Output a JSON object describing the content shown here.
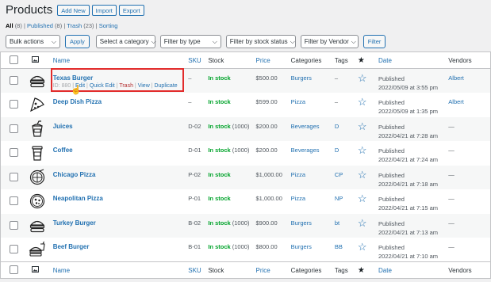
{
  "header": {
    "title": "Products",
    "add_new": "Add New",
    "import": "Import",
    "export": "Export"
  },
  "views": {
    "all": "All",
    "all_count": "(8)",
    "published": "Published",
    "published_count": "(8)",
    "trash": "Trash",
    "trash_count": "(23)",
    "sorting": "Sorting",
    "sep": "|"
  },
  "filters": {
    "bulk_actions": "Bulk actions",
    "apply": "Apply",
    "category": "Select a category",
    "type": "Filter by type",
    "stock": "Filter by stock status",
    "vendor": "Filter by Vendor",
    "filter": "Filter"
  },
  "columns": {
    "name": "Name",
    "sku": "SKU",
    "stock": "Stock",
    "price": "Price",
    "categories": "Categories",
    "tags": "Tags",
    "date": "Date",
    "vendors": "Vendors"
  },
  "row_actions": {
    "id": "ID: 880",
    "edit": "Edit",
    "quick_edit": "Quick Edit",
    "trash": "Trash",
    "view": "View",
    "duplicate": "Duplicate",
    "sep": "|"
  },
  "products": [
    {
      "name": "Texas Burger",
      "sku": "–",
      "stock": "In stock",
      "stock_qty": "",
      "price": "$500.00",
      "category": "Burgers",
      "tag": "–",
      "date_status": "Published",
      "date": "2022/05/09 at 3:55 pm",
      "vendor": "Albert",
      "icon": "burger-icon"
    },
    {
      "name": "Deep Dish Pizza",
      "sku": "–",
      "stock": "In stock",
      "stock_qty": "",
      "price": "$599.00",
      "category": "Pizza",
      "tag": "–",
      "date_status": "Published",
      "date": "2022/05/09 at 1:35 pm",
      "vendor": "Albert",
      "icon": "pizza-slice-icon"
    },
    {
      "name": "Juices",
      "sku": "D-02",
      "stock": "In stock",
      "stock_qty": "(1000)",
      "price": "$200.00",
      "category": "Beverages",
      "tag": "D",
      "date_status": "Published",
      "date": "2022/04/21 at 7:28 am",
      "vendor": "—",
      "icon": "juice-cup-icon"
    },
    {
      "name": "Coffee",
      "sku": "D-01",
      "stock": "In stock",
      "stock_qty": "(1000)",
      "price": "$200.00",
      "category": "Beverages",
      "tag": "D",
      "date_status": "Published",
      "date": "2022/04/21 at 7:24 am",
      "vendor": "—",
      "icon": "coffee-cup-icon"
    },
    {
      "name": "Chicago Pizza",
      "sku": "P-02",
      "stock": "In stock",
      "stock_qty": "",
      "price": "$1,000.00",
      "category": "Pizza",
      "tag": "CP",
      "date_status": "Published",
      "date": "2022/04/21 at 7:18 am",
      "vendor": "—",
      "icon": "pizza-whole-icon"
    },
    {
      "name": "Neapolitan Pizza",
      "sku": "P-01",
      "stock": "In stock",
      "stock_qty": "",
      "price": "$1,000.00",
      "category": "Pizza",
      "tag": "NP",
      "date_status": "Published",
      "date": "2022/04/21 at 7:15 am",
      "vendor": "—",
      "icon": "pizza-round-icon"
    },
    {
      "name": "Turkey Burger",
      "sku": "B-02",
      "stock": "In stock",
      "stock_qty": "(1000)",
      "price": "$900.00",
      "category": "Burgers",
      "tag": "bt",
      "date_status": "Published",
      "date": "2022/04/21 at 7:13 am",
      "vendor": "—",
      "icon": "burger-icon"
    },
    {
      "name": "Beef Burger",
      "sku": "B-01",
      "stock": "In stock",
      "stock_qty": "(1000)",
      "price": "$800.00",
      "category": "Burgers",
      "tag": "BB",
      "date_status": "Published",
      "date": "2022/04/21 at 7:10 am",
      "vendor": "—",
      "icon": "burger-drink-icon"
    }
  ]
}
